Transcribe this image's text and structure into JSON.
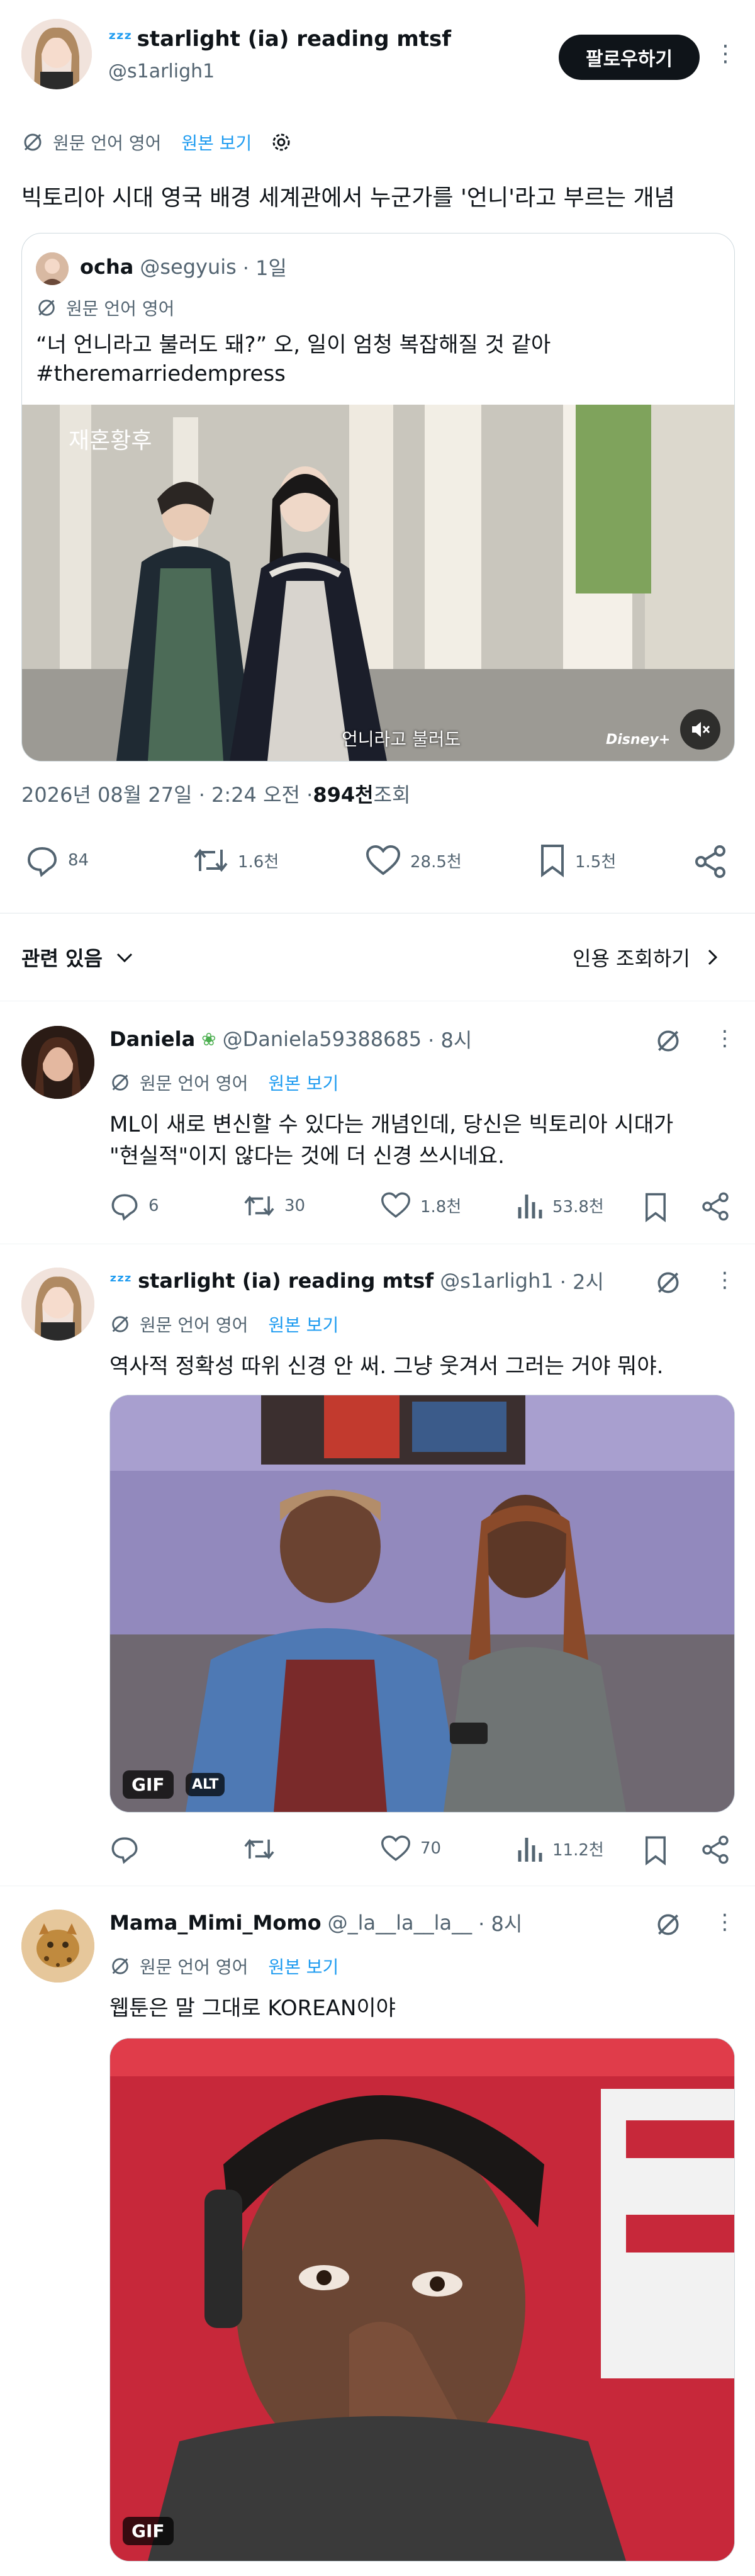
{
  "main_post": {
    "display_name": "starlight (ia) reading mtsf",
    "handle": "@s1arligh1",
    "follow_label": "팔로우하기",
    "translation_note": "원문 언어 영어",
    "view_original": "원본 보기",
    "text": "빅토리아 시대 영국 배경 세계관에서 누군가를 '언니'라고 부르는 개념",
    "timestamp": "2026년 08월 27일 · 2:24 오전 · ",
    "views_count": "894천",
    "views_label": " 조회",
    "stats": {
      "replies": "84",
      "reposts": "1.6천",
      "likes": "28.5천",
      "bookmarks": "1.5천"
    }
  },
  "quoted_post": {
    "display_name": "ocha",
    "handle": "@segyuis",
    "time": "· 1일",
    "translation_note": "원문 언어 영어",
    "text_line1": "“너 언니라고 불러도 돼?” 오, 일이 엄청 복잡해질 것 같아",
    "text_line2": "#theremarriedempress",
    "video_title_overlay": "재혼황후",
    "subtitle": "언니라고 불러도",
    "watermark": "Disney+"
  },
  "relevance": {
    "label": "관련 있음",
    "quote_views": "인용 조회하기"
  },
  "replies": [
    {
      "display_name": "Daniela",
      "handle": "@Daniela59388685",
      "time": "· 8시",
      "translation_note": "원문 언어 영어",
      "view_original": "원본 보기",
      "text_line1": "ML이 새로 변신할 수 있다는 개념인데, 당신은 빅토리아 시대가",
      "text_line2": "\"현실적\"이지 않다는 것에 더 신경 쓰시네요.",
      "stats": {
        "replies": "6",
        "reposts": "30",
        "likes": "1.8천",
        "views": "53.8천"
      }
    },
    {
      "display_name": "starlight (ia) reading mtsf",
      "handle": "@s1arligh1",
      "time": "· 2시",
      "translation_note": "원문 언어 영어",
      "view_original": "원본 보기",
      "text": "역사적 정확성 따위 신경 안 써. 그냥 웃겨서 그러는 거야 뭐야.",
      "gif_label": "GIF",
      "alt_label": "ALT",
      "stats": {
        "replies": "",
        "reposts": "",
        "likes": "70",
        "views": "11.2천"
      }
    },
    {
      "display_name": "Mama_Mimi_Momo",
      "handle": "@_la__la__la__",
      "time": "· 8시",
      "translation_note": "원문 언어 영어",
      "view_original": "원본 보기",
      "text": "웹툰은 말 그대로 KOREAN이야",
      "gif_label": "GIF"
    }
  ]
}
